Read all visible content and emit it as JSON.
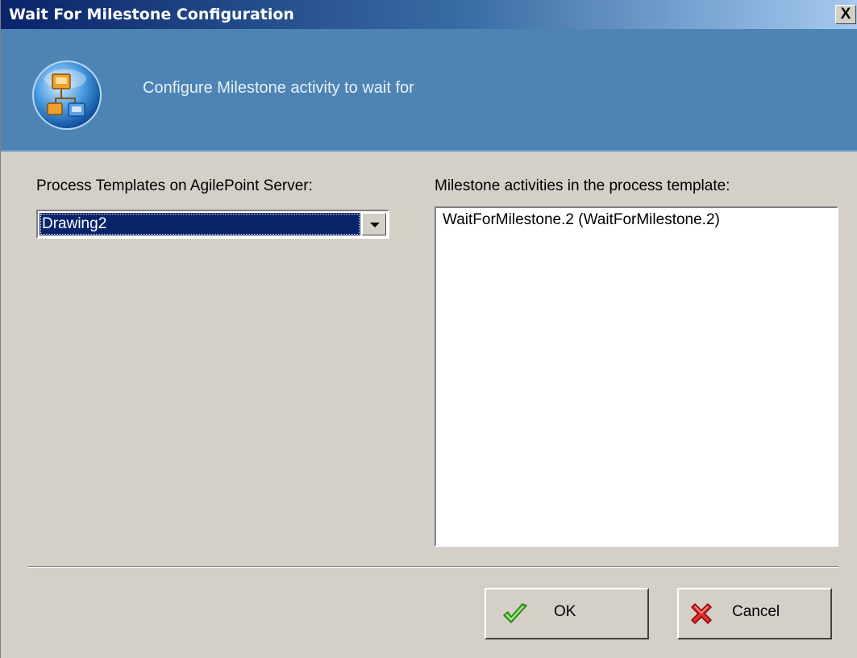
{
  "window": {
    "title": "Wait For Milestone Configuration",
    "close_glyph": "X"
  },
  "banner": {
    "text": "Configure Milestone activity to wait for",
    "icon": "process-template-icon"
  },
  "left": {
    "label": "Process Templates on AgilePoint Server:",
    "select": {
      "value": "Drawing2"
    }
  },
  "right": {
    "label": "Milestone activities in the process template:",
    "items": [
      "WaitForMilestone.2 (WaitForMilestone.2)"
    ]
  },
  "buttons": {
    "ok_label": "OK",
    "ok_icon": "checkmark-icon",
    "cancel_label": "Cancel",
    "cancel_icon": "red-x-icon"
  },
  "colors": {
    "title_bar_start": "#0a246a",
    "banner": "#4d84b4",
    "dialog": "#d4d0c8",
    "selection": "#0a246a"
  }
}
